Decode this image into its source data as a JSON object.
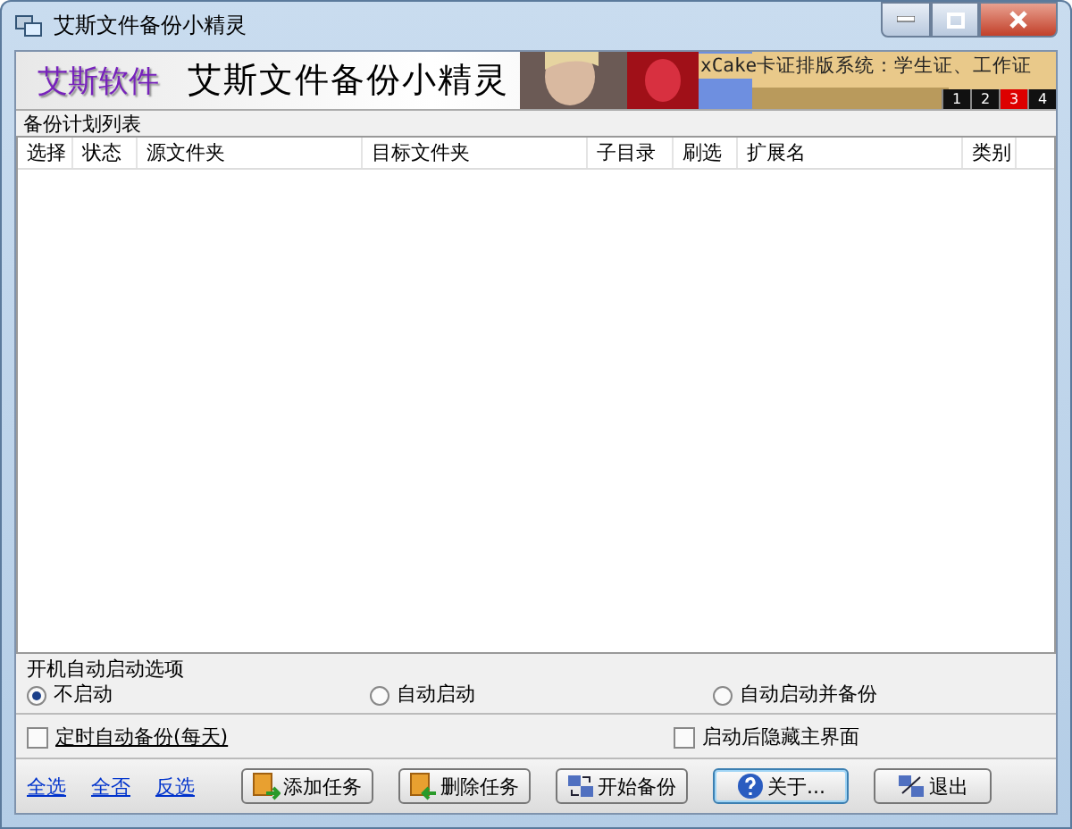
{
  "window": {
    "title": "艾斯文件备份小精灵"
  },
  "banner": {
    "brand": "艾斯软件",
    "app_name": "艾斯文件备份小精灵",
    "ad": {
      "text": "xCake卡证排版系统：学生证、工作证",
      "pages": [
        {
          "label": "1",
          "selected": false
        },
        {
          "label": "2",
          "selected": false
        },
        {
          "label": "3",
          "selected": true
        },
        {
          "label": "4",
          "selected": false
        }
      ]
    }
  },
  "task_list": {
    "title": "备份计划列表",
    "columns": [
      "选择",
      "状态",
      "源文件夹",
      "目标文件夹",
      "子目录",
      "刷选",
      "扩展名",
      "类别"
    ]
  },
  "startup": {
    "title": "开机自动启动选项",
    "options": [
      {
        "label": "不启动",
        "selected": true
      },
      {
        "label": "自动启动",
        "selected": false
      },
      {
        "label": "自动启动并备份",
        "selected": false
      }
    ]
  },
  "checkboxes": [
    {
      "label": "定时自动备份(每天)",
      "checked": false,
      "underlined": true
    },
    {
      "label": "启动后隐藏主界面",
      "checked": false,
      "underlined": false
    }
  ],
  "links": [
    "全选",
    "全否",
    "反选"
  ],
  "buttons": [
    {
      "label": "添加任务",
      "kind": "add"
    },
    {
      "label": "删除任务",
      "kind": "delete"
    },
    {
      "label": "开始备份",
      "kind": "start"
    },
    {
      "label": "关于...",
      "kind": "about"
    },
    {
      "label": "退出",
      "kind": "exit"
    }
  ]
}
